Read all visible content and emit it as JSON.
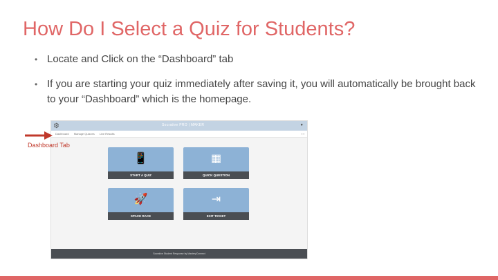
{
  "title": "How Do I Select a Quiz for Students?",
  "bullets": [
    "Locate and Click on the “Dashboard” tab",
    "If you are starting your quiz immediately after saving it, you will automatically be brought back to your “Dashboard” which is the homepage."
  ],
  "bullet_glyph": "•",
  "callout": "Dashboard Tab",
  "screenshot": {
    "brand": "Socrative PRO | MAKER",
    "nav": [
      "Dashboard",
      "Manage Quizzes",
      "Live Results"
    ],
    "tiles": [
      {
        "label": "START A QUIZ",
        "icon": "phone-signal-icon"
      },
      {
        "label": "QUICK QUESTION",
        "icon": "chart-icon"
      },
      {
        "label": "SPACE RACE",
        "icon": "rocket-icon"
      },
      {
        "label": "EXIT TICKET",
        "icon": "door-icon"
      }
    ],
    "footer": "Socrative Student Response by MasteryConnect"
  },
  "colors": {
    "accent": "#e06666",
    "tile": "#8db2d6",
    "tile_label": "#4a4e53"
  }
}
